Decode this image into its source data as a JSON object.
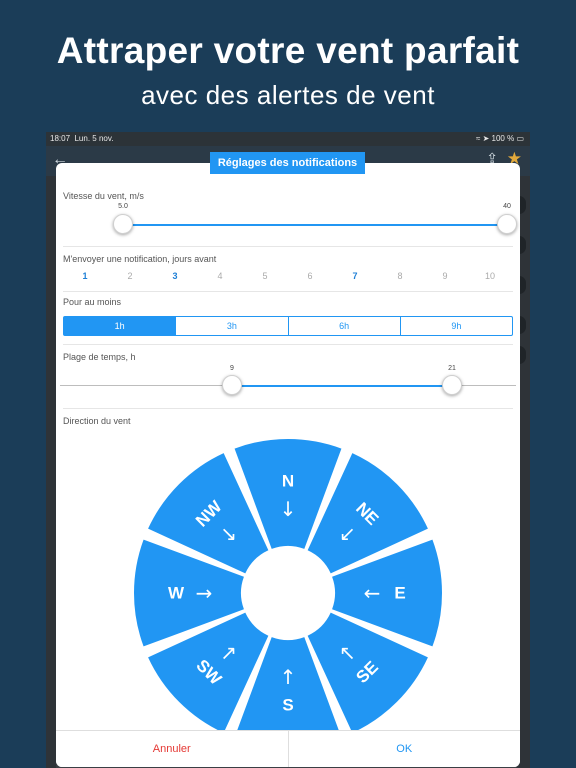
{
  "promo": {
    "title": "Attraper votre vent parfait",
    "subtitle": "avec des alertes de vent"
  },
  "statusbar": {
    "time": "18:07",
    "date": "Lun. 5 nov.",
    "battery": "100 %"
  },
  "icons": {
    "back": "arrow-left-icon",
    "share": "share-icon",
    "favorite": "star-icon",
    "wifi": "wifi-icon",
    "location": "location-arrow-icon",
    "battery": "battery-icon"
  },
  "modal": {
    "title": "Réglages des notifications",
    "wind_speed": {
      "label": "Vitesse du vent, m/s",
      "min_value": "5.0",
      "max_value": "40"
    },
    "days_before": {
      "label": "M'envoyer une notification, jours avant",
      "days": [
        "1",
        "2",
        "3",
        "4",
        "5",
        "6",
        "7",
        "8",
        "9",
        "10"
      ],
      "active": [
        "1",
        "3",
        "7"
      ]
    },
    "duration": {
      "label": "Pour au moins",
      "options": [
        "1h",
        "3h",
        "6h",
        "9h"
      ],
      "selected": "1h"
    },
    "time_range": {
      "label": "Plage de temps, h",
      "start": "9",
      "end": "21"
    },
    "direction": {
      "label": "Direction du vent",
      "sectors": [
        "N",
        "NE",
        "E",
        "SE",
        "S",
        "SW",
        "W",
        "NW"
      ],
      "arrows": {
        "N": "↓",
        "NE": "↙",
        "E": "←",
        "SE": "↖",
        "S": "↑",
        "SW": "↗",
        "W": "→",
        "NW": "↘"
      }
    },
    "cancel_label": "Annuler",
    "ok_label": "OK"
  },
  "colors": {
    "accent": "#2196f3",
    "cancel": "#e53935",
    "background": "#1b3d58"
  }
}
